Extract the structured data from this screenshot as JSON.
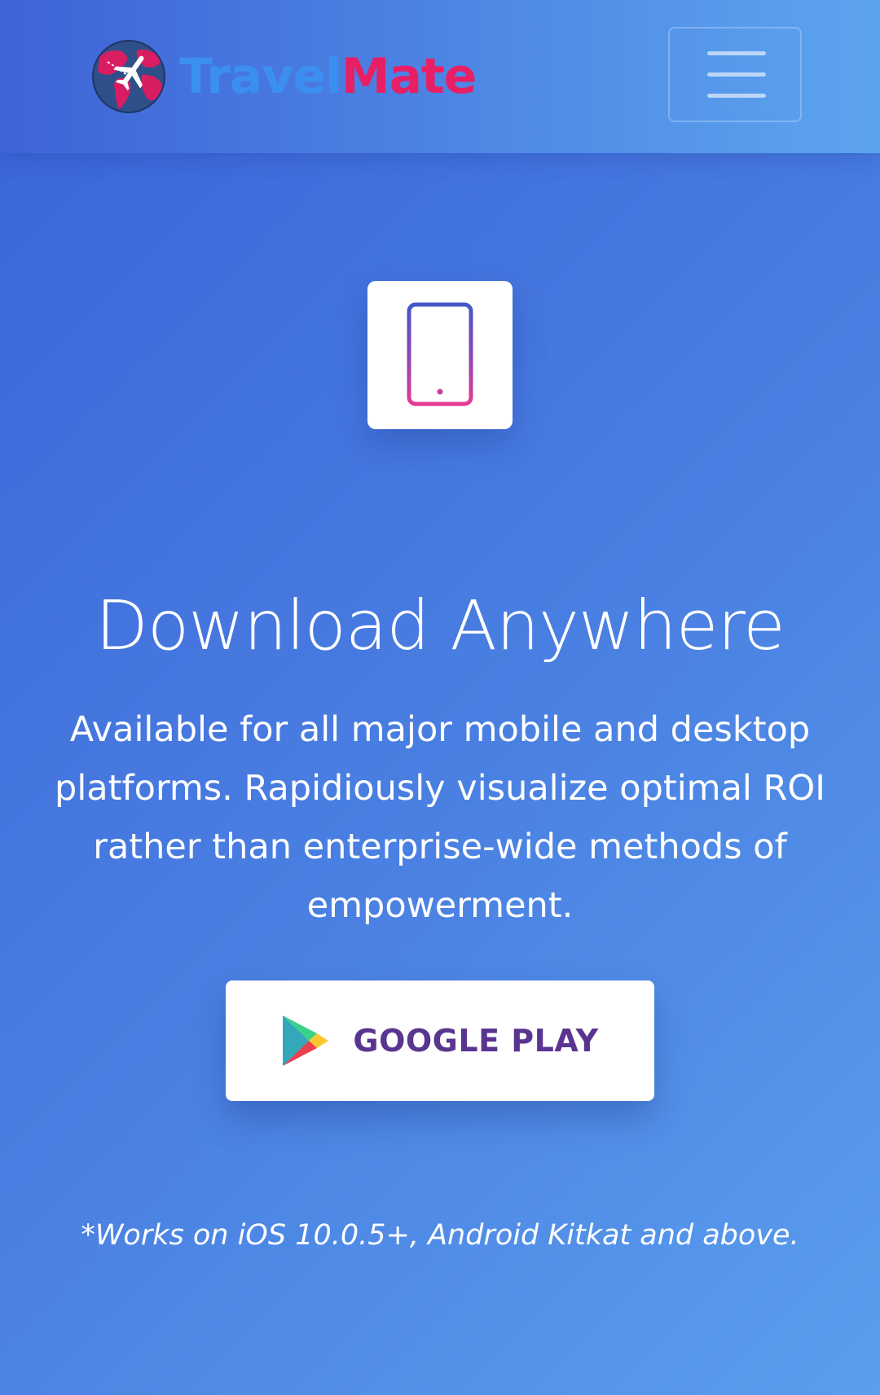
{
  "navbar": {
    "brand_part1": "Travel",
    "brand_part2": "Mate",
    "menu_icon": "hamburger-menu-icon"
  },
  "feature": {
    "icon": "tablet-icon",
    "headline": "Download Anywhere",
    "description": "Available for all major mobile and desktop platforms. Rapidiously visualize optimal ROI rather than enterprise-wide methods of empowerment."
  },
  "store_button": {
    "icon": "google-play-icon",
    "label": "GOOGLE PLAY"
  },
  "footnote": "*Works on iOS 10.0.5+, Android Kitkat and above.",
  "colors": {
    "brand_blue": "#3a8ff0",
    "brand_pink": "#e81f64",
    "button_text": "#5a3590",
    "background_start": "#3a63d8",
    "background_end": "#5a9eee"
  }
}
